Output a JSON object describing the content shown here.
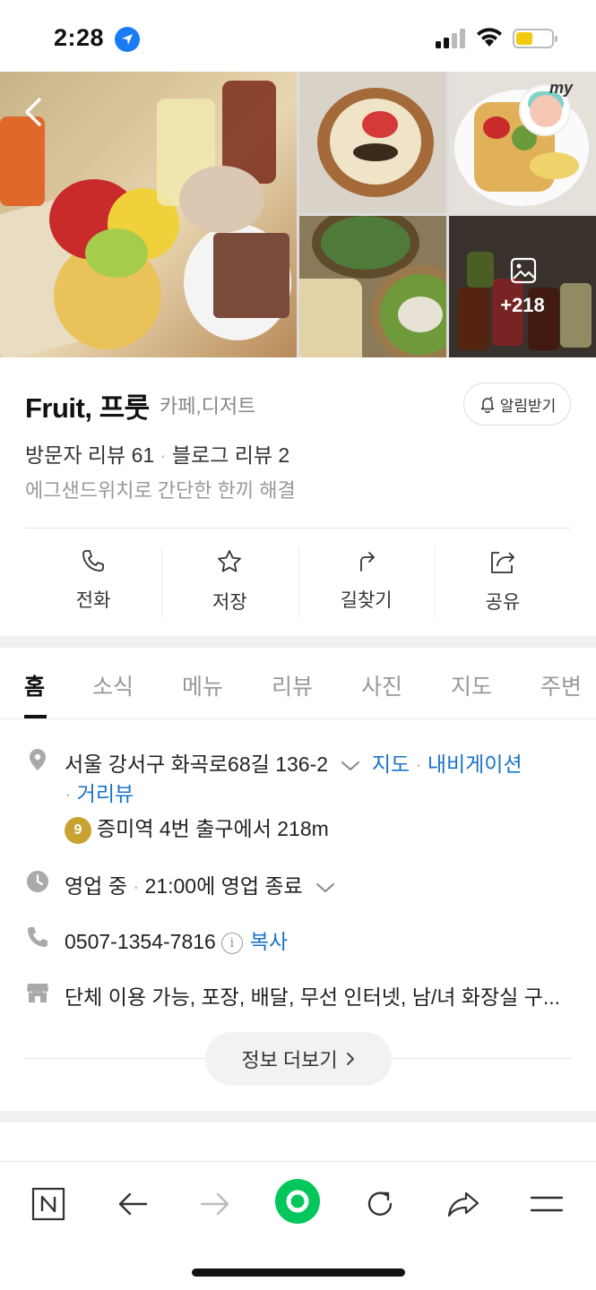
{
  "status_bar": {
    "time": "2:28"
  },
  "photos": {
    "more_count": "+218",
    "my_label": "my"
  },
  "place": {
    "name": "Fruit, 프룻",
    "category": "카페,디저트",
    "alarm_label": "알림받기",
    "visitor_reviews": "방문자 리뷰 61",
    "blog_reviews": "블로그 리뷰 2",
    "description": "에그샌드위치로 간단한 한끼 해결"
  },
  "actions": [
    {
      "label": "전화",
      "icon": "phone-icon"
    },
    {
      "label": "저장",
      "icon": "star-icon"
    },
    {
      "label": "길찾기",
      "icon": "directions-icon"
    },
    {
      "label": "공유",
      "icon": "share-icon"
    }
  ],
  "tabs": [
    "홈",
    "소식",
    "메뉴",
    "리뷰",
    "사진",
    "지도",
    "주변"
  ],
  "info": {
    "address": "서울 강서구 화곡로68길 136-2",
    "map_link": "지도",
    "navi_link": "내비게이션",
    "street_view_link": "거리뷰",
    "subway_line": "9",
    "subway_text": "증미역 4번 출구에서 218m",
    "hours_status": "영업 중",
    "hours_detail": "21:00에 영업 종료",
    "phone": "0507-1354-7816",
    "copy_label": "복사",
    "amenities": "단체 이용 가능, 포장, 배달, 무선 인터넷, 남/녀 화장실 구...",
    "more_info_label": "정보 더보기"
  },
  "colors": {
    "link": "#1a73c8",
    "naver_green": "#03c75a",
    "subway_line9": "#c8a230"
  }
}
